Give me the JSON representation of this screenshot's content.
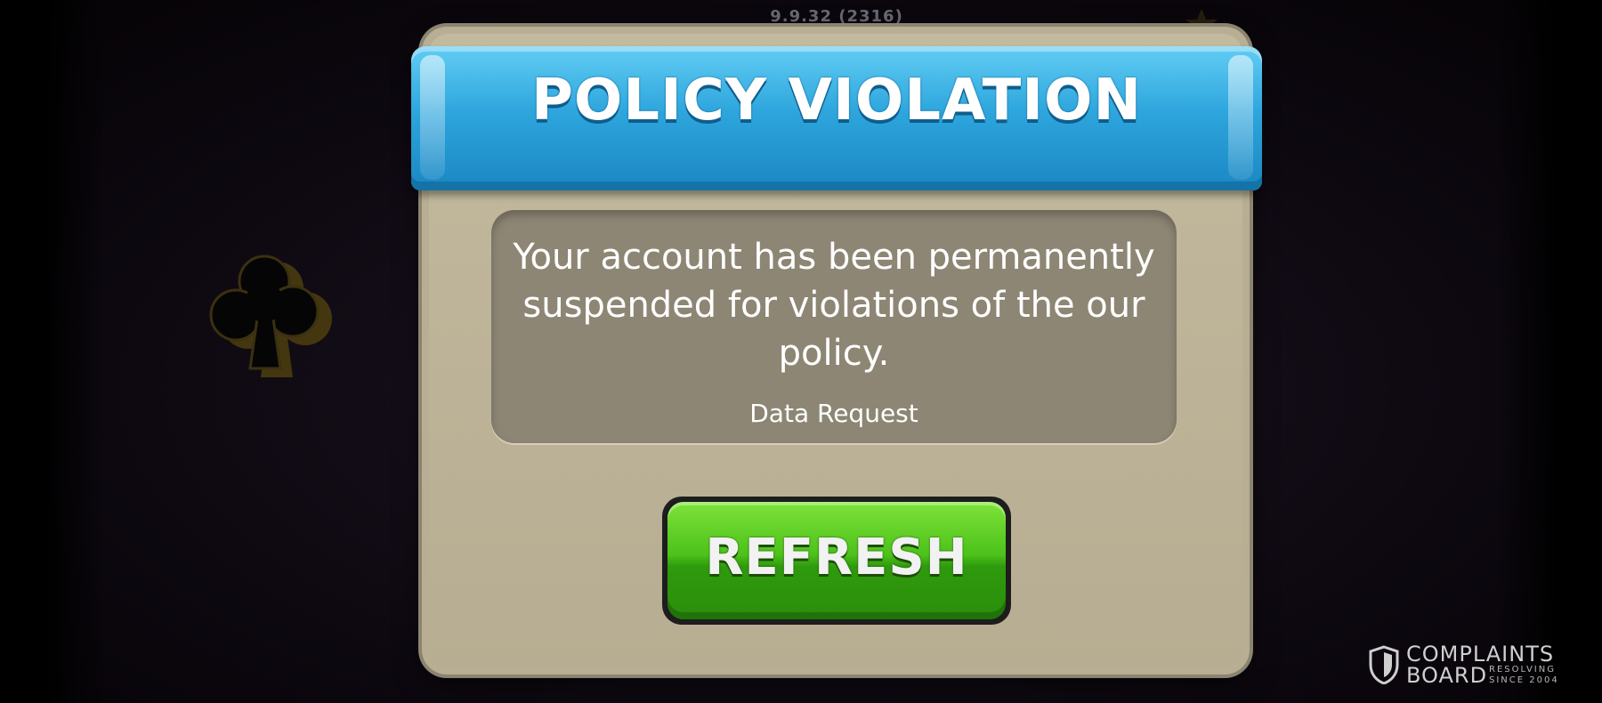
{
  "game": {
    "version": "9.9.32 (2316)"
  },
  "dialog": {
    "title": "POLICY VIOLATION",
    "message": "Your account has been permanently suspended for violations of the our policy.",
    "link_label": "Data Request",
    "refresh_label": "REFRESH"
  },
  "background": {
    "club_icon": "club-icon",
    "star_icon": "star-icon"
  },
  "watermark": {
    "line1": "COMPLAINTS",
    "line2": "BOARD",
    "tagline": "RESOLVING SINCE 2004",
    "icon": "shield-icon"
  },
  "colors": {
    "ribbon": "#2ea6dd",
    "panel": "#b8ae94",
    "message_box": "#8e8675",
    "button": "#4cc21a"
  }
}
